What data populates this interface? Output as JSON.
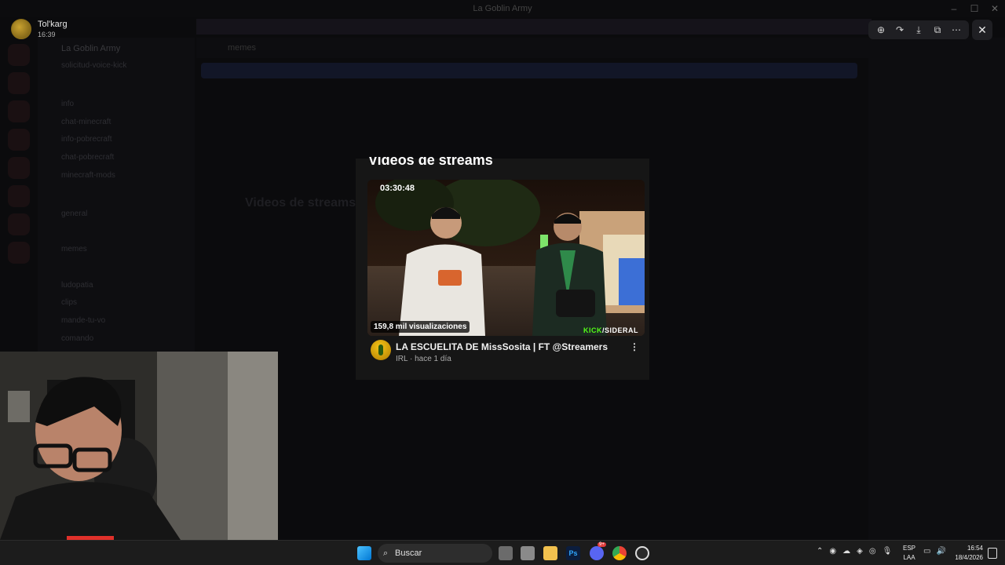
{
  "window": {
    "title": "La Goblin Army"
  },
  "viewer": {
    "user_name": "Tol'karg",
    "user_time": "16:39"
  },
  "server": {
    "name": "La Goblin Army",
    "channels": [
      "solicitud-voice-kick",
      "info",
      "chat-minecraft",
      "info-pobrecraft",
      "chat-pobrecraft",
      "minecraft-mods",
      "general",
      "memes",
      "ludopatia",
      "clips",
      "mande-tu-vo",
      "comando"
    ]
  },
  "chat_header": {
    "channel": "memes"
  },
  "ghost": {
    "title": "Videos de streams"
  },
  "card": {
    "section_title": "Videos de streams",
    "duration": "03:30:48",
    "views": "159,8 mil visualizaciones",
    "watermark_a": "KICK",
    "watermark_b": "/SIDERAL",
    "video_title": "LA ESCUELITA DE MissSosita | FT @Streamers",
    "video_meta": "IRL · hace 1 día"
  },
  "tools": {
    "icons": [
      "zoom-icon",
      "forward-icon",
      "download-icon",
      "open-external-icon",
      "more-icon",
      "close-icon"
    ]
  },
  "taskbar": {
    "search_placeholder": "Buscar",
    "lang_top": "ESP",
    "lang_bottom": "LAA",
    "time": "16:54",
    "date": "18/4/2026",
    "discord_badge": "9+"
  },
  "colors": {
    "accent_kick": "#53fc18",
    "card_bg": "#161616"
  }
}
